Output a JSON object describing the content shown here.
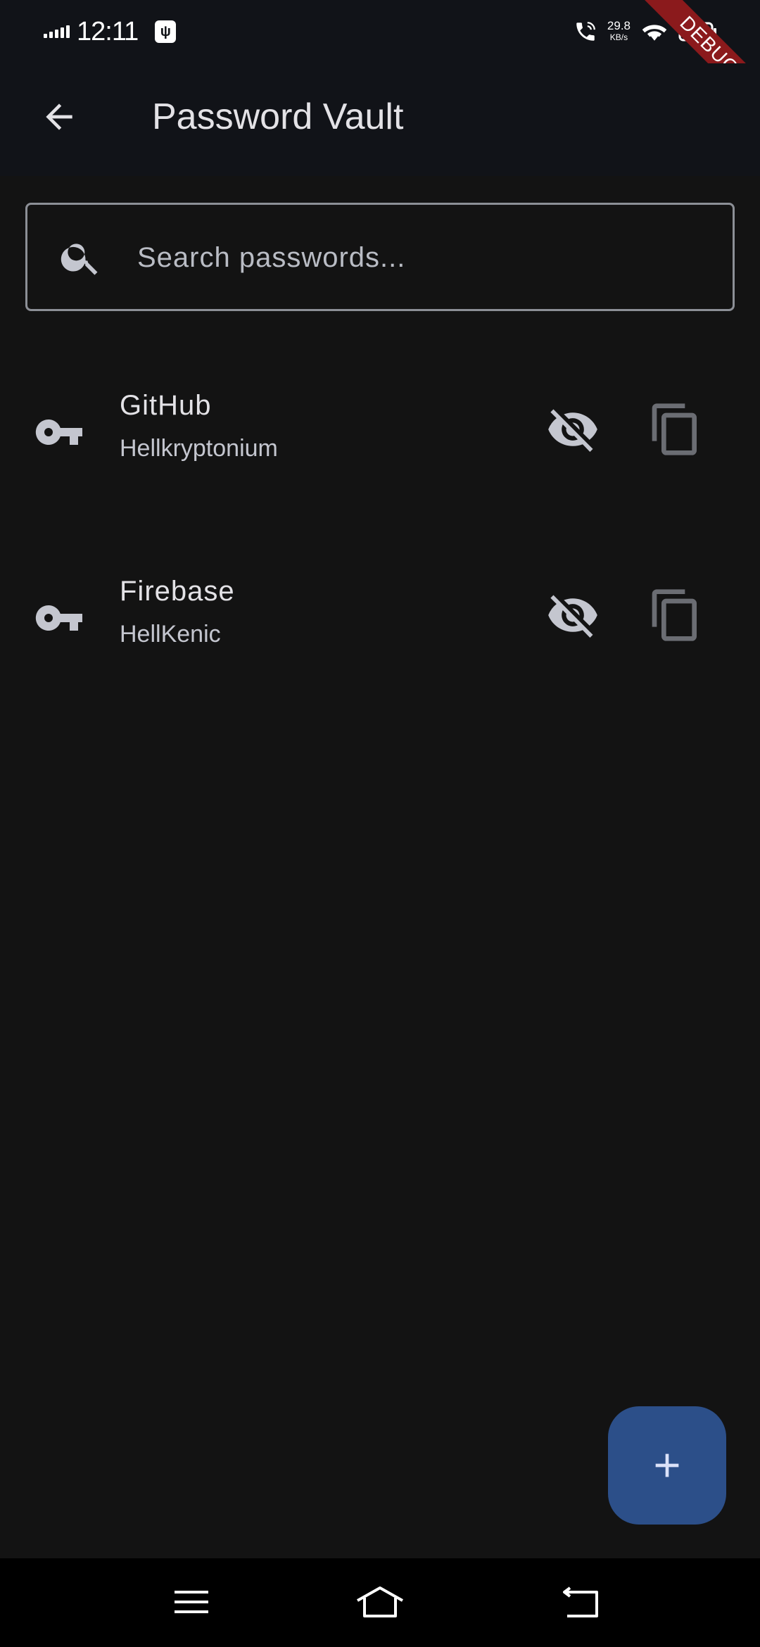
{
  "status_bar": {
    "time": "12:11",
    "network_speed": "29.8",
    "network_speed_unit": "KB/s",
    "icons": [
      "signal-icon",
      "usb-icon",
      "call-icon",
      "wifi-icon",
      "battery-icon"
    ]
  },
  "debug_banner": "DEBUG",
  "app_bar": {
    "title": "Password Vault",
    "back_icon": "arrow-back-icon"
  },
  "search": {
    "placeholder": "Search passwords...",
    "value": ""
  },
  "entries": [
    {
      "name": "GitHub",
      "username": "Hellkryptonium"
    },
    {
      "name": "Firebase",
      "username": "HellKenic"
    }
  ],
  "fab": {
    "icon": "add-icon"
  },
  "colors": {
    "background": "#131313",
    "app_bar": "#111318",
    "fab": "#2c4f89",
    "debug": "#8b1a1c"
  }
}
